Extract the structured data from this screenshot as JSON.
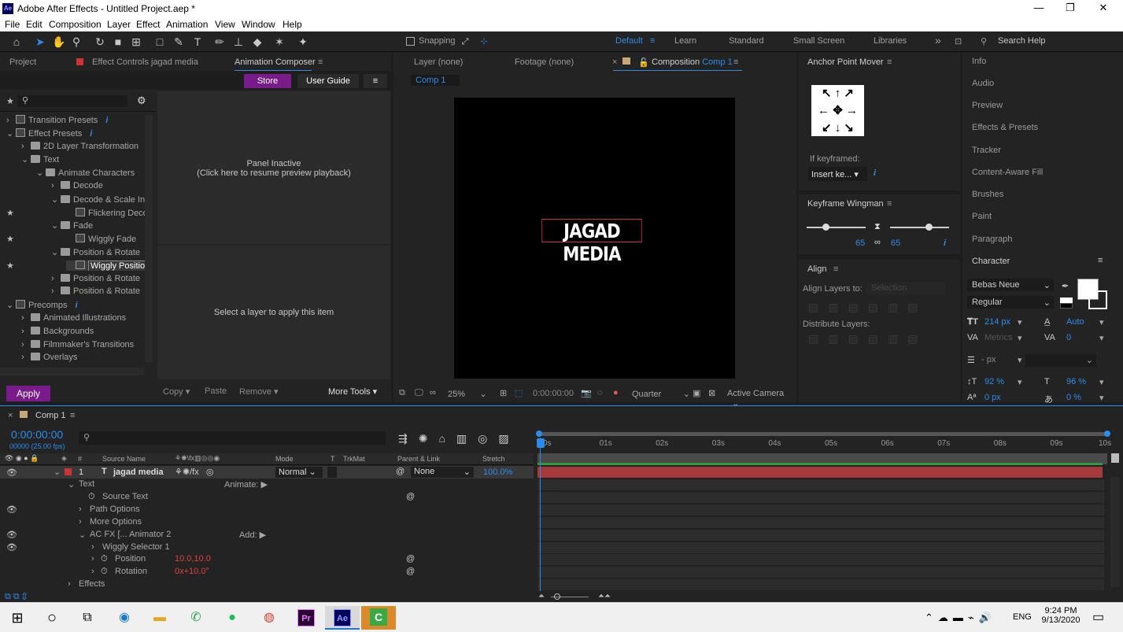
{
  "window": {
    "title": "Adobe After Effects - Untitled Project.aep *",
    "app_icon": "Ae",
    "controls": [
      "—",
      "❐",
      "✕"
    ]
  },
  "menu": [
    "File",
    "Edit",
    "Composition",
    "Layer",
    "Effect",
    "Animation",
    "View",
    "Window",
    "Help"
  ],
  "toolbar": {
    "snapping": "Snapping",
    "workspaces": [
      "Default",
      "Learn",
      "Standard",
      "Small Screen",
      "Libraries"
    ],
    "more": "»",
    "search_placeholder": "Search Help"
  },
  "left_tabs": {
    "project": "Project",
    "effect_controls": "Effect Controls jagad media",
    "animation_composer": "Animation Composer"
  },
  "ac": {
    "store": "Store",
    "user_guide": "User Guide",
    "panel_inactive": "Panel Inactive",
    "resume": "(Click here to resume preview playback)",
    "select_layer": "Select a layer to apply this item",
    "apply": "Apply",
    "copy": "Copy",
    "paste": "Paste",
    "remove": "Remove",
    "more_tools": "More Tools"
  },
  "tree": [
    {
      "label": "Transition Presets",
      "indent": 0,
      "arrow": "›",
      "type": "fx",
      "info": true,
      "star": false
    },
    {
      "label": "Effect Presets",
      "indent": 0,
      "arrow": "⌄",
      "type": "fx",
      "info": true,
      "star": false
    },
    {
      "label": "2D Layer Transformation",
      "indent": 1,
      "arrow": "›",
      "type": "folder",
      "star": false
    },
    {
      "label": "Text",
      "indent": 1,
      "arrow": "⌄",
      "type": "folder",
      "star": false
    },
    {
      "label": "Animate Characters",
      "indent": 2,
      "arrow": "⌄",
      "type": "folder",
      "star": false
    },
    {
      "label": "Decode",
      "indent": 3,
      "arrow": "›",
      "type": "folder",
      "star": false
    },
    {
      "label": "Decode & Scale In",
      "indent": 3,
      "arrow": "⌄",
      "type": "folder",
      "star": false
    },
    {
      "label": "Flickering Decode",
      "indent": 4,
      "arrow": "",
      "type": "fx",
      "star": true
    },
    {
      "label": "Fade",
      "indent": 3,
      "arrow": "⌄",
      "type": "folder",
      "star": false
    },
    {
      "label": "Wiggly Fade",
      "indent": 4,
      "arrow": "",
      "type": "fx",
      "star": true
    },
    {
      "label": "Position & Rotate",
      "indent": 3,
      "arrow": "⌄",
      "type": "folder",
      "star": false
    },
    {
      "label": "Wiggly Position",
      "indent": 4,
      "arrow": "",
      "type": "fx",
      "star": true,
      "selected": true
    },
    {
      "label": "Position & Rotate",
      "indent": 3,
      "arrow": "›",
      "type": "folder",
      "star": false
    },
    {
      "label": "Position & Rotate",
      "indent": 3,
      "arrow": "›",
      "type": "folder",
      "star": false
    },
    {
      "label": "Precomps",
      "indent": 0,
      "arrow": "⌄",
      "type": "fx",
      "info": true,
      "star": false
    },
    {
      "label": "Animated Illustrations",
      "indent": 1,
      "arrow": "›",
      "type": "folder",
      "star": false
    },
    {
      "label": "Backgrounds",
      "indent": 1,
      "arrow": "›",
      "type": "folder",
      "star": false
    },
    {
      "label": "Filmmaker's Transitions",
      "indent": 1,
      "arrow": "›",
      "type": "folder",
      "star": false
    },
    {
      "label": "Overlays",
      "indent": 1,
      "arrow": "›",
      "type": "folder",
      "star": false
    }
  ],
  "viewer": {
    "tab_layer": "Layer  (none)",
    "tab_footage": "Footage  (none)",
    "tab_comp": "Composition",
    "comp_name": "Comp 1",
    "comp_chip": "Comp 1",
    "text": "JAGAD MEDIA",
    "zoom": "25%",
    "timecode": "0:00:00:00",
    "quality": "Quarter",
    "camera": "Active Camera"
  },
  "anchor": {
    "title": "Anchor Point Mover",
    "if_keyframed": "If keyframed:",
    "insert": "Insert ke..."
  },
  "wingman": {
    "title": "Keyframe Wingman",
    "v1": "65",
    "v2": "65"
  },
  "align": {
    "title": "Align",
    "align_to": "Align Layers to:",
    "selection": "Selection",
    "distribute": "Distribute Layers:"
  },
  "right_panels": [
    "Info",
    "Audio",
    "Preview",
    "Effects & Presets",
    "Tracker",
    "Content-Aware Fill",
    "Brushes",
    "Paint",
    "Paragraph"
  ],
  "character": {
    "title": "Character",
    "font": "Bebas Neue",
    "style": "Regular",
    "size": "214 px",
    "leading": "Auto",
    "kerning": "Metrics",
    "tracking": "0",
    "stroke": "- px",
    "vscale": "92 %",
    "hscale": "96 %",
    "baseline": "0 px",
    "tsume": "0 %"
  },
  "timeline": {
    "tab": "Comp 1",
    "timecode": "0:00:00:00",
    "fps": "00000 (25.00 fps)",
    "headers": {
      "source": "Source Name",
      "mode": "Mode",
      "t": "T",
      "trkmat": "TrkMat",
      "parent": "Parent & Link",
      "stretch": "Stretch"
    },
    "layer": {
      "num": "1",
      "name": "jagad media",
      "mode": "Normal",
      "parent": "None",
      "stretch": "100.0%"
    },
    "props": [
      {
        "label": "Text",
        "indent": 0,
        "extra": "Animate:"
      },
      {
        "label": "Source Text",
        "indent": 1,
        "extra": ""
      },
      {
        "label": "Path Options",
        "indent": 1,
        "extra": ""
      },
      {
        "label": "More Options",
        "indent": 1,
        "extra": ""
      },
      {
        "label": "AC FX [... Animator 2",
        "indent": 1,
        "extra": "Add:"
      },
      {
        "label": "Wiggly Selector 1",
        "indent": 2,
        "extra": ""
      },
      {
        "label": "Position",
        "indent": 2,
        "extra": "",
        "value": "10.0,10.0"
      },
      {
        "label": "Rotation",
        "indent": 2,
        "extra": "",
        "value": "0x+10.0°"
      },
      {
        "label": "Effects",
        "indent": 0,
        "extra": ""
      }
    ],
    "ruler": [
      "0s",
      "01s",
      "02s",
      "03s",
      "04s",
      "05s",
      "06s",
      "07s",
      "08s",
      "09s",
      "10s"
    ]
  },
  "taskbar": {
    "time": "9:24 PM",
    "date": "9/13/2020",
    "lang": "ENG"
  },
  "colors": {
    "accent": "#2d8ceb",
    "store": "#7a1b8c",
    "apply": "#7a1b8c",
    "layer_bar": "#a63a3a"
  }
}
